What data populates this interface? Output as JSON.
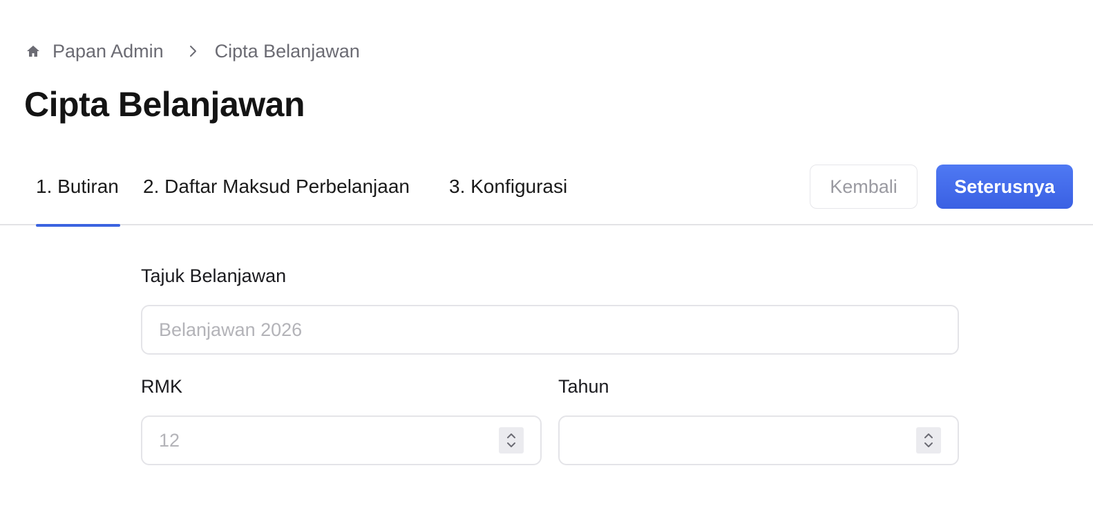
{
  "breadcrumb": {
    "home_icon": "home-icon",
    "items": [
      {
        "label": "Papan Admin"
      },
      {
        "label": "Cipta Belanjawan"
      }
    ],
    "separator_icon": "chevron-right-icon"
  },
  "page": {
    "title": "Cipta Belanjawan"
  },
  "steps": {
    "tabs": [
      {
        "label": "1. Butiran",
        "active": true
      },
      {
        "label": "2. Daftar Maksud Perbelanjaan",
        "active": false
      },
      {
        "label": "3. Konfigurasi",
        "active": false
      }
    ],
    "back_label": "Kembali",
    "next_label": "Seterusnya"
  },
  "form": {
    "title_field": {
      "label": "Tajuk Belanjawan",
      "placeholder": "Belanjawan 2026",
      "value": ""
    },
    "rmk_field": {
      "label": "RMK",
      "placeholder": "12",
      "value": ""
    },
    "year_field": {
      "label": "Tahun",
      "placeholder": "",
      "value": ""
    }
  },
  "colors": {
    "accent": "#3b63e0",
    "primary_button": "#4470ea",
    "muted_text": "#6b6b73",
    "placeholder": "#b3b3b8"
  }
}
